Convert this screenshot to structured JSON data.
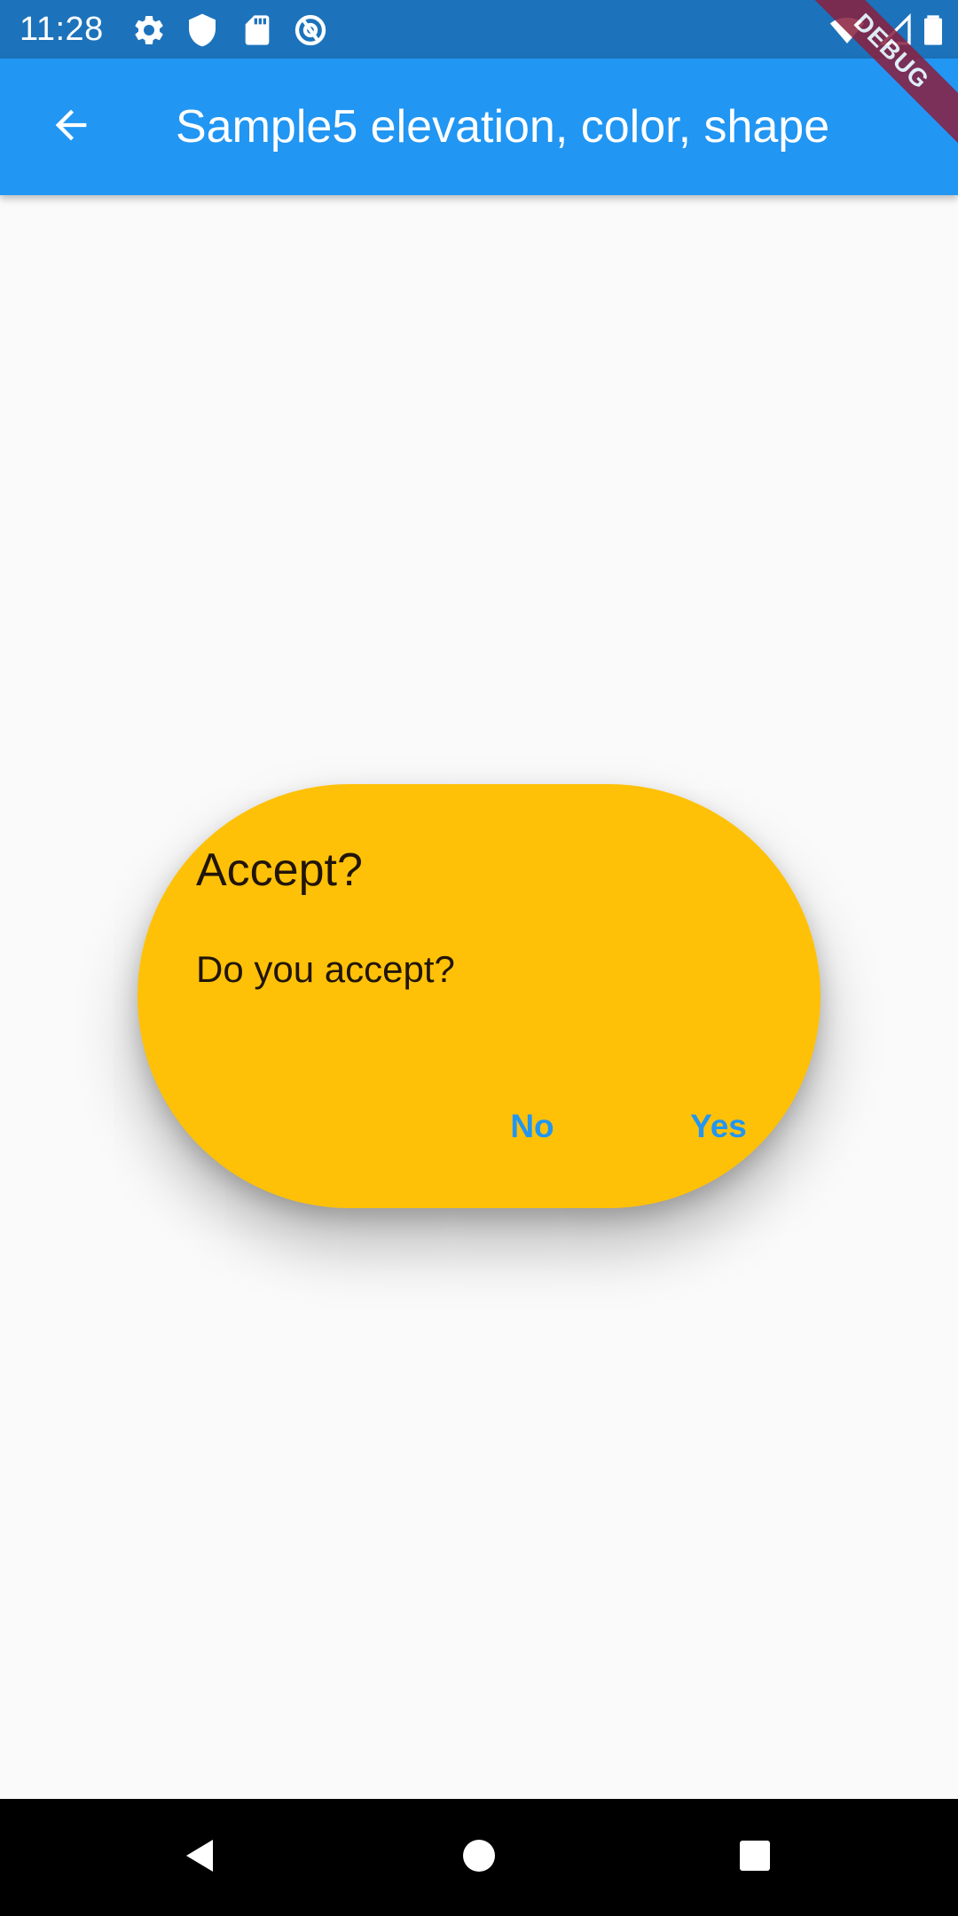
{
  "status_bar": {
    "time": "11:28",
    "left_icons": [
      "gear-icon",
      "shield-icon",
      "sd-card-icon",
      "at-sign-icon"
    ],
    "right_icons": [
      "wifi-icon",
      "signal-icon",
      "battery-icon"
    ]
  },
  "app_bar": {
    "title": "Sample5 elevation, color, shape",
    "back_icon": "arrow-left-icon"
  },
  "debug_banner": {
    "label": "DEBUG"
  },
  "dialog": {
    "title": "Accept?",
    "content": "Do you accept?",
    "actions": {
      "no": "No",
      "yes": "Yes"
    },
    "background_color": "#ffc107",
    "action_color": "#2196f3"
  },
  "nav_bar": {
    "buttons": [
      "back-triangle-icon",
      "home-circle-icon",
      "recents-square-icon"
    ]
  },
  "colors": {
    "status_bar": "#1c73bb",
    "app_bar": "#2196f3",
    "page_background": "#fafafa"
  }
}
